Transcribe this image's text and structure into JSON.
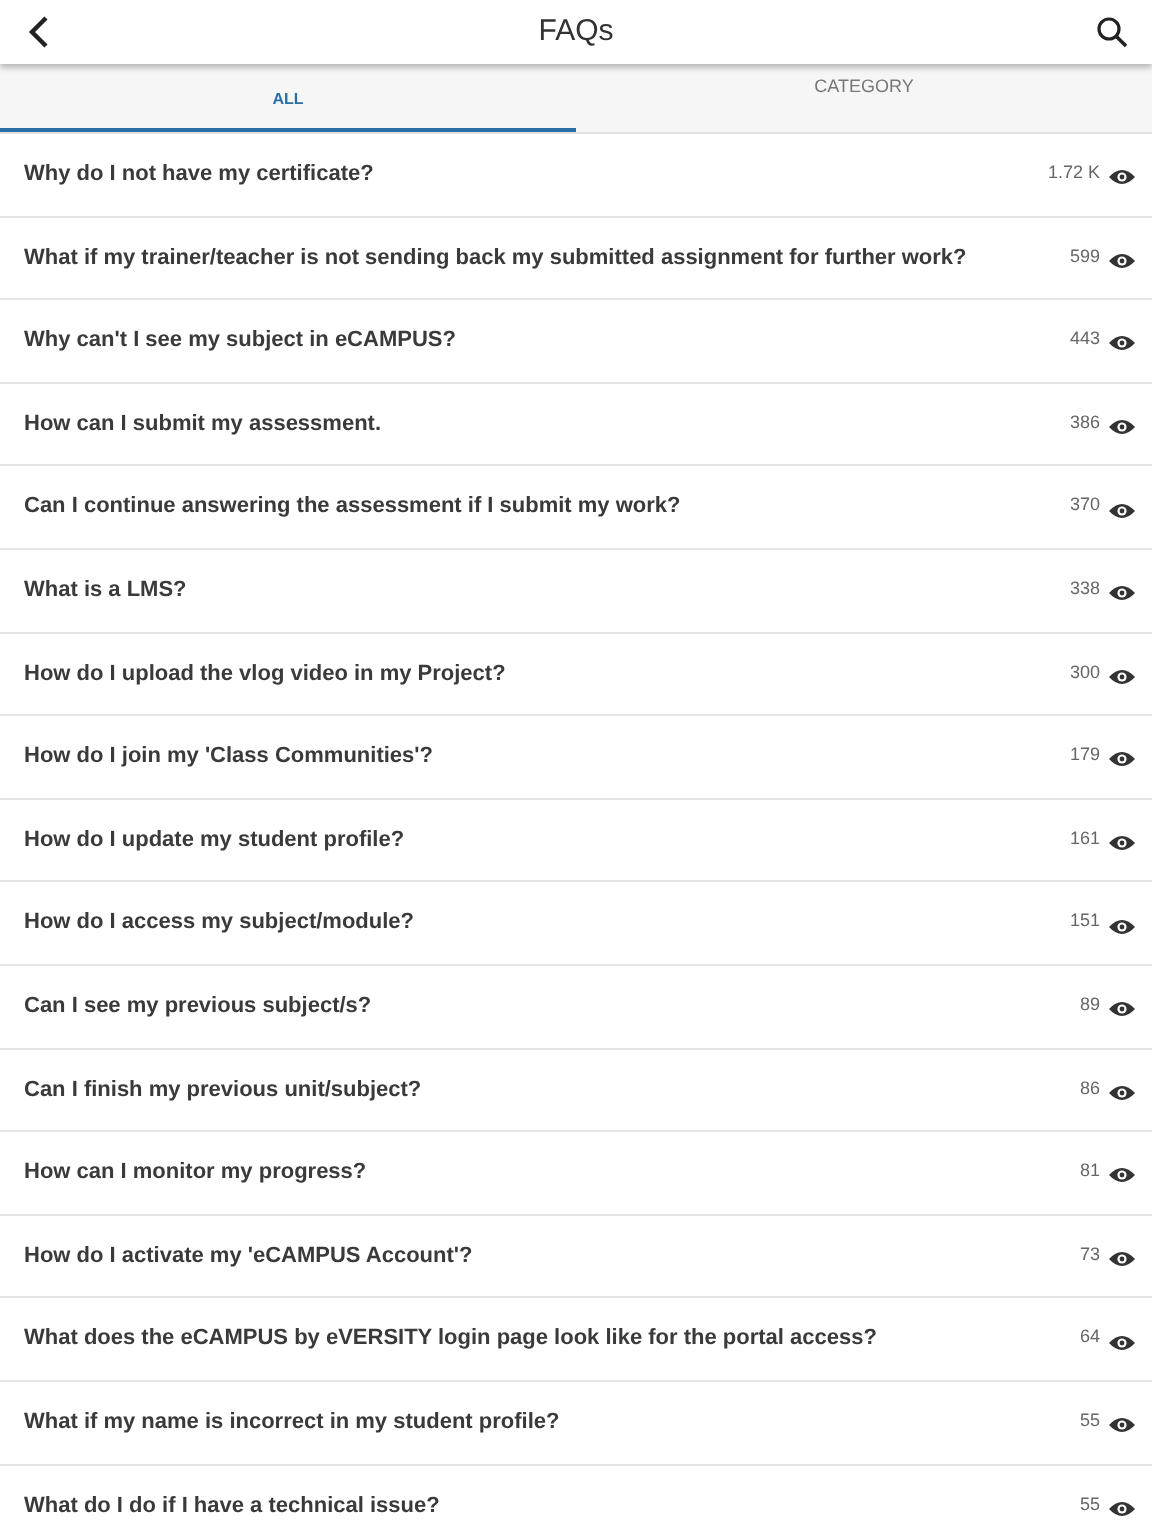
{
  "header": {
    "title": "FAQs"
  },
  "tabs": [
    {
      "label": "ALL",
      "selected": true
    },
    {
      "label": "CATEGORY",
      "selected": false
    }
  ],
  "faqs": [
    {
      "question": "Why do I not have my certificate?",
      "views": "1.72 K"
    },
    {
      "question": "What if my trainer/teacher is not sending back my submitted assignment for further work?",
      "views": "599"
    },
    {
      "question": "Why can't I see my subject in eCAMPUS?",
      "views": "443"
    },
    {
      "question": "How can I submit my assessment.",
      "views": "386"
    },
    {
      "question": "Can I continue answering the assessment if I submit my work?",
      "views": "370"
    },
    {
      "question": "What is a LMS?",
      "views": "338"
    },
    {
      "question": "How do I upload the vlog video in my Project?",
      "views": "300"
    },
    {
      "question": "How do I join my 'Class Communities'?",
      "views": "179"
    },
    {
      "question": "How do I update my student profile?",
      "views": "161"
    },
    {
      "question": "How do I access my subject/module?",
      "views": "151"
    },
    {
      "question": "Can I see my previous subject/s?",
      "views": "89"
    },
    {
      "question": "Can I finish my previous unit/subject?",
      "views": "86"
    },
    {
      "question": "How can I monitor my progress?",
      "views": "81"
    },
    {
      "question": "How do I activate my 'eCAMPUS Account'?",
      "views": "73"
    },
    {
      "question": "What does the eCAMPUS by eVERSITY login page look like for the portal access?",
      "views": "64"
    },
    {
      "question": "What if my name is incorrect in my student profile?",
      "views": "55"
    },
    {
      "question": "What do I do if I have a technical issue?",
      "views": "55"
    }
  ]
}
